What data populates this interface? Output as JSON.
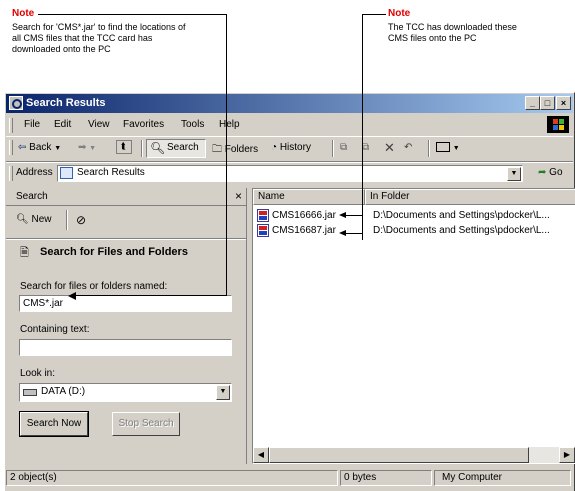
{
  "notes": [
    {
      "title": "Note",
      "text": "Search for 'CMS*.jar' to find the locations of all CMS files that the TCC card  has downloaded onto the PC"
    },
    {
      "title": "Note",
      "text": "The TCC has downloaded these CMS files onto the PC"
    }
  ],
  "window": {
    "title": "Search Results",
    "controls": {
      "minimize": "_",
      "maximize": "□",
      "close": "×"
    }
  },
  "menu": [
    "File",
    "Edit",
    "View",
    "Favorites",
    "Tools",
    "Help"
  ],
  "toolbar": {
    "back": "Back",
    "search": "Search",
    "folders": "Folders",
    "history": "History"
  },
  "address": {
    "label": "Address",
    "value": "Search Results",
    "go": "Go"
  },
  "search_pane": {
    "header": "Search",
    "close": "×",
    "new_label": "New",
    "heading": "Search for Files and Folders",
    "name_label": "Search for files or folders named:",
    "name_value": "CMS*.jar",
    "text_label": "Containing text:",
    "text_value": "",
    "look_in_label": "Look in:",
    "look_in_value": "DATA (D:)",
    "search_now": "Search Now",
    "stop_search": "Stop Search"
  },
  "results": {
    "columns": [
      "Name",
      "In Folder"
    ],
    "rows": [
      {
        "name": "CMS16666.jar",
        "folder": "D:\\Documents and Settings\\pdocker\\L..."
      },
      {
        "name": "CMS16687.jar",
        "folder": "D:\\Documents and Settings\\pdocker\\L..."
      }
    ]
  },
  "status": {
    "objects": "2 object(s)",
    "size": "0 bytes",
    "zone": "My Computer"
  }
}
